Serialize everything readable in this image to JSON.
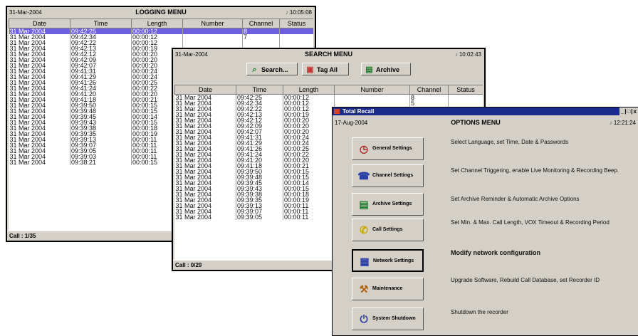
{
  "logging": {
    "date": "31-Mar-2004",
    "title": "LOGGING MENU",
    "time": "10:05:08",
    "columns": [
      "Date",
      "Time",
      "Length",
      "Number",
      "Channel",
      "Status"
    ],
    "rows": [
      [
        "31 Mar 2004",
        "09:42:25",
        "00:00:12",
        "",
        "8",
        ""
      ],
      [
        "31 Mar 2004",
        "09:42:34",
        "00:00:12",
        "",
        "7",
        ""
      ],
      [
        "31 Mar 2004",
        "09:42:22",
        "00:00:12",
        "",
        "",
        ""
      ],
      [
        "31 Mar 2004",
        "09:42:13",
        "00:00:19",
        "",
        "",
        ""
      ],
      [
        "31 Mar 2004",
        "09:42:12",
        "00:00:20",
        "",
        "",
        ""
      ],
      [
        "31 Mar 2004",
        "09:42:09",
        "00:00:20",
        "",
        "",
        ""
      ],
      [
        "31 Mar 2004",
        "09:42:07",
        "00:00:20",
        "",
        "",
        ""
      ],
      [
        "31 Mar 2004",
        "09:41:31",
        "00:00:24",
        "",
        "",
        ""
      ],
      [
        "31 Mar 2004",
        "09:41:29",
        "00:00:24",
        "",
        "",
        ""
      ],
      [
        "31 Mar 2004",
        "09:41:26",
        "00:00:25",
        "",
        "",
        ""
      ],
      [
        "31 Mar 2004",
        "09:41:24",
        "00:00:22",
        "",
        "",
        ""
      ],
      [
        "31 Mar 2004",
        "09:41:20",
        "00:00:20",
        "",
        "",
        ""
      ],
      [
        "31 Mar 2004",
        "09:41:18",
        "00:00:21",
        "",
        "",
        ""
      ],
      [
        "31 Mar 2004",
        "09:39:50",
        "00:00:15",
        "",
        "",
        ""
      ],
      [
        "31 Mar 2004",
        "09:39:48",
        "00:00:15",
        "",
        "",
        ""
      ],
      [
        "31 Mar 2004",
        "09:39:45",
        "00:00:14",
        "",
        "",
        ""
      ],
      [
        "31 Mar 2004",
        "09:39:43",
        "00:00:15",
        "",
        "",
        ""
      ],
      [
        "31 Mar 2004",
        "09:39:38",
        "00:00:18",
        "",
        "",
        ""
      ],
      [
        "31 Mar 2004",
        "09:39:35",
        "00:00:19",
        "",
        "",
        ""
      ],
      [
        "31 Mar 2004",
        "09:39:13",
        "00:00:11",
        "",
        "",
        ""
      ],
      [
        "31 Mar 2004",
        "09:39:07",
        "00:00:11",
        "",
        "",
        ""
      ],
      [
        "31 Mar 2004",
        "09:39:05",
        "00:00:11",
        "",
        "",
        ""
      ],
      [
        "31 Mar 2004",
        "09:39:03",
        "00:00:11",
        "",
        "",
        ""
      ],
      [
        "31 Mar 2004",
        "09:38:21",
        "00:00:15",
        "",
        "",
        ""
      ]
    ],
    "status": "Call : 1/35"
  },
  "search": {
    "date": "31-Mar-2004",
    "title": "SEARCH MENU",
    "time": "10:02:43",
    "buttons": {
      "search": {
        "label": "Search...",
        "icon": "magnifier-icon"
      },
      "tagall": {
        "label": "Tag All",
        "icon": "tag-icon"
      },
      "archive": {
        "label": "Archive",
        "icon": "archive-icon"
      }
    },
    "columns": [
      "Date",
      "Time",
      "Length",
      "Number",
      "Channel",
      "Status"
    ],
    "rows": [
      [
        "31 Mar 2004",
        "09:42:25",
        "00:00:12",
        "",
        "8",
        ""
      ],
      [
        "31 Mar 2004",
        "09:42:34",
        "00:00:12",
        "",
        "5",
        ""
      ],
      [
        "31 Mar 2004",
        "09:42:22",
        "00:00:12",
        "",
        "",
        ""
      ],
      [
        "31 Mar 2004",
        "09:42:13",
        "00:00:19",
        "",
        "",
        ""
      ],
      [
        "31 Mar 2004",
        "09:42:12",
        "00:00:20",
        "",
        "",
        ""
      ],
      [
        "31 Mar 2004",
        "09:42:09",
        "00:00:20",
        "",
        "",
        ""
      ],
      [
        "31 Mar 2004",
        "09:42:07",
        "00:00:20",
        "",
        "",
        ""
      ],
      [
        "31 Mar 2004",
        "09:41:31",
        "00:00:24",
        "",
        "",
        ""
      ],
      [
        "31 Mar 2004",
        "09:41:29",
        "00:00:24",
        "",
        "",
        ""
      ],
      [
        "31 Mar 2004",
        "09:41:26",
        "00:00:25",
        "",
        "",
        ""
      ],
      [
        "31 Mar 2004",
        "09:41:24",
        "00:00:22",
        "",
        "",
        ""
      ],
      [
        "31 Mar 2004",
        "09:41:20",
        "00:00:20",
        "",
        "",
        ""
      ],
      [
        "31 Mar 2004",
        "09:41:18",
        "00:00:21",
        "",
        "",
        ""
      ],
      [
        "31 Mar 2004",
        "09:39:50",
        "00:00:15",
        "",
        "",
        ""
      ],
      [
        "31 Mar 2004",
        "09:39:48",
        "00:00:15",
        "",
        "",
        ""
      ],
      [
        "31 Mar 2004",
        "09:39:45",
        "00:00:14",
        "",
        "",
        ""
      ],
      [
        "31 Mar 2004",
        "09:39:43",
        "00:00:15",
        "",
        "",
        ""
      ],
      [
        "31 Mar 2004",
        "09:39:38",
        "00:00:18",
        "",
        "",
        ""
      ],
      [
        "31 Mar 2004",
        "09:39:35",
        "00:00:19",
        "",
        "",
        ""
      ],
      [
        "31 Mar 2004",
        "09:39:13",
        "00:00:11",
        "",
        "",
        ""
      ],
      [
        "31 Mar 2004",
        "09:39:07",
        "00:00:11",
        "",
        "",
        ""
      ],
      [
        "31 Mar 2004",
        "09:39:05",
        "00:00:11",
        "",
        "",
        ""
      ]
    ],
    "status": "Call : 0/29"
  },
  "options": {
    "window_title": "Total Recall",
    "window_controls": "_|□|x",
    "date": "17-Aug-2004",
    "title": "OPTIONS MENU",
    "time": "12:21:24",
    "items": [
      {
        "label": "General Settings",
        "icon": "clock-icon",
        "desc": "Select Language, set Time, Date & Passwords"
      },
      {
        "label": "Channel Settings",
        "icon": "phone-icon",
        "desc": "Set Channel Triggering, enable Live Monitoring & Recording Beep."
      },
      {
        "label": "Archive Settings",
        "icon": "archive-icon",
        "desc": "Set Archive Reminder & Automatic Archive Options"
      },
      {
        "label": "Call Settings",
        "icon": "call-icon",
        "desc": "Set Min. & Max. Call Length, VOX Timeout & Recording Period"
      },
      {
        "label": "Network Settings",
        "icon": "network-icon",
        "desc": "Modify network configuration"
      },
      {
        "label": "Maintenance",
        "icon": "maintenance-icon",
        "desc": "Upgrade Software, Rebuild Call Database, set Recorder ID"
      },
      {
        "label": "System Shutdown",
        "icon": "shutdown-icon",
        "desc": "Shutdown the recorder"
      }
    ]
  }
}
